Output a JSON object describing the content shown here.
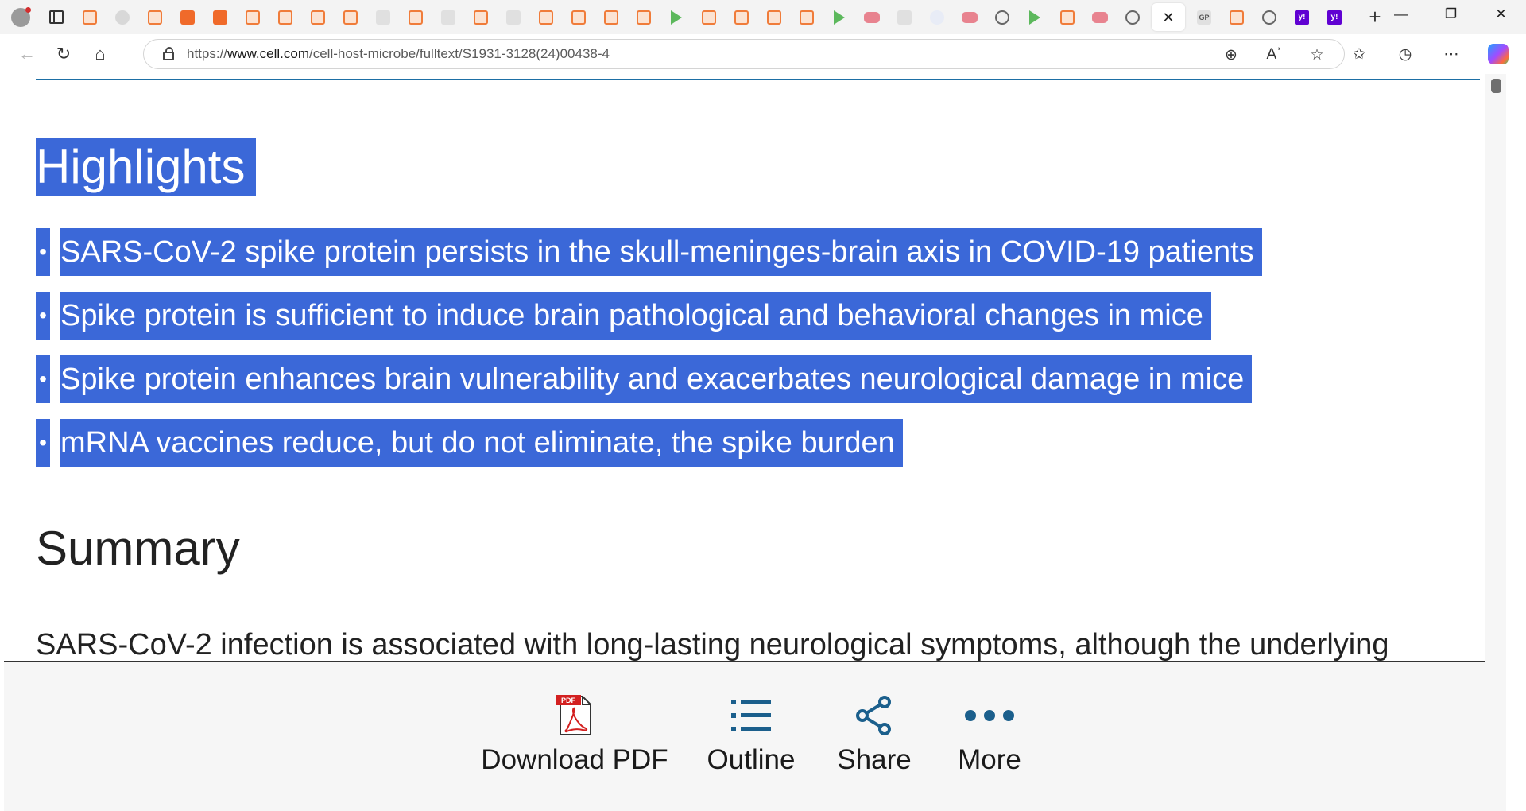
{
  "browser": {
    "tabs": [
      {
        "icon": "bookmark"
      },
      {
        "icon": "globe"
      },
      {
        "icon": "bookmark"
      },
      {
        "icon": "bookmark-solid"
      },
      {
        "icon": "bookmark-solid"
      },
      {
        "icon": "bookmark"
      },
      {
        "icon": "bookmark"
      },
      {
        "icon": "bookmark"
      },
      {
        "icon": "bookmark"
      },
      {
        "icon": "gray"
      },
      {
        "icon": "bookmark"
      },
      {
        "icon": "gray"
      },
      {
        "icon": "bookmark"
      },
      {
        "icon": "gray"
      },
      {
        "icon": "bookmark"
      },
      {
        "icon": "bookmark"
      },
      {
        "icon": "bookmark"
      },
      {
        "icon": "bookmark"
      },
      {
        "icon": "play"
      },
      {
        "icon": "bookmark"
      },
      {
        "icon": "bookmark"
      },
      {
        "icon": "bookmark"
      },
      {
        "icon": "bookmark"
      },
      {
        "icon": "play"
      },
      {
        "icon": "youtube"
      },
      {
        "icon": "gray"
      },
      {
        "icon": "search"
      },
      {
        "icon": "youtube"
      },
      {
        "icon": "brain"
      },
      {
        "icon": "play"
      },
      {
        "icon": "bookmark"
      },
      {
        "icon": "youtube"
      },
      {
        "icon": "brain"
      },
      {
        "icon": "active"
      },
      {
        "icon": "gray",
        "text": "GP"
      },
      {
        "icon": "bookmark"
      },
      {
        "icon": "brain"
      },
      {
        "icon": "yahoo",
        "text": "y!"
      },
      {
        "icon": "yahoo",
        "text": "y!"
      }
    ],
    "new_tab_glyph": "+",
    "url_prefix": "https://",
    "url_host": "www.cell.com",
    "url_path": "/cell-host-microbe/fulltext/S1931-3128(24)00438-4"
  },
  "article": {
    "highlights_title": "Highlights",
    "highlights": [
      "SARS-CoV-2 spike protein persists in the skull-meninges-brain axis in COVID-19 patients",
      "Spike protein is sufficient to induce brain pathological and behavioral changes in mice",
      "Spike protein enhances brain vulnerability and exacerbates neurological damage in mice",
      "mRNA vaccines reduce, but do not eliminate, the spike burden"
    ],
    "summary_title": "Summary",
    "summary_text": "SARS-CoV-2 infection is associated with long-lasting neurological symptoms, although the underlying"
  },
  "actions": {
    "download_pdf": "Download PDF",
    "outline": "Outline",
    "share": "Share",
    "more": "More",
    "pdf_badge": "PDF"
  },
  "colors": {
    "selection": "#3b68d8",
    "accent_line": "#1d6fa5",
    "icon_blue": "#1b5f8c",
    "pdf_red": "#d32020"
  }
}
